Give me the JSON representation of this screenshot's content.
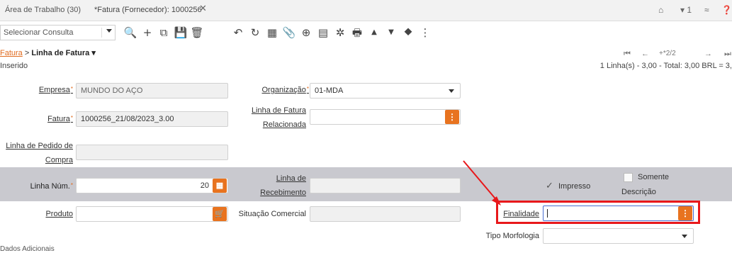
{
  "tabs": {
    "workarea": "Área de Trabalho (30)",
    "active": "*Fatura (Fornecedor): 1000256",
    "close": "✕"
  },
  "top_right": {
    "home": "⌂",
    "notif": "▾ 1",
    "collapse": "≈",
    "help": "❓"
  },
  "toolbar": {
    "query_placeholder": "Selecionar Consulta",
    "icons": [
      "search-icon",
      "add-icon",
      "copy-icon",
      "save-icon",
      "delete-icon",
      "undo-icon",
      "refresh-icon",
      "grid-toggle-icon",
      "attachment-icon",
      "zoom-icon",
      "report-icon",
      "settings-icon",
      "print-icon",
      "previous-icon",
      "next-icon",
      "tag-icon",
      "more-icon"
    ],
    "glyphs": [
      "🔍",
      "+",
      "⧉",
      "💾",
      "🗑",
      "↶",
      "↻",
      "▦",
      "📎",
      "⊕",
      "▤",
      "✲",
      "🖶",
      "▲",
      "▼",
      "⯁",
      "⋮"
    ]
  },
  "breadcrumb": {
    "parent": "Fatura",
    "sep": ">",
    "current": "Linha de Fatura ▾"
  },
  "nav": {
    "first": "⏮",
    "prev": "←",
    "pos": "+*2/2",
    "next": "→",
    "last": "⏭"
  },
  "status": {
    "left": "Inserido",
    "right": "1 Linha(s) - 3,00 - Total: 3,00 BRL = 3,"
  },
  "form": {
    "empresa_label": "Empresa",
    "empresa_value": "MUNDO DO AÇO",
    "organizacao_label": "Organização",
    "organizacao_value": "01-MDA",
    "fatura_label": "Fatura",
    "fatura_value": "1000256_21/08/2023_3.00",
    "linha_fatura_rel_label1": "Linha de Fatura",
    "linha_fatura_rel_label2": "Relacionada",
    "linha_pedido_label1": "Linha de Pedido de",
    "linha_pedido_label2": "Compra",
    "linha_num_label": "Linha Núm.",
    "linha_num_value": "20",
    "linha_receb_label1": "Linha de",
    "linha_receb_label2": "Recebimento",
    "impresso_label": "Impresso",
    "somente_label1": "Somente",
    "somente_label2": "Descrição",
    "produto_label": "Produto",
    "situacao_label": "Situação Comercial",
    "finalidade_label": "Finalidade",
    "tipo_morf_label": "Tipo Morfologia",
    "dados_adicionais": "Dados Adicionais"
  },
  "colors": {
    "accent": "#e8731f",
    "highlight": "#e8181b",
    "band": "#c9c9cf"
  }
}
